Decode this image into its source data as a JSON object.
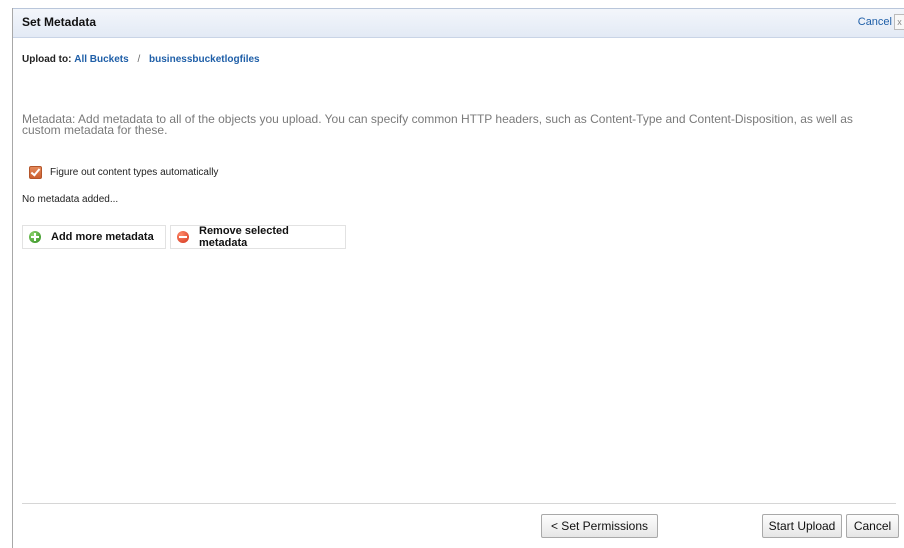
{
  "dialog": {
    "title": "Set Metadata",
    "header_cancel": "Cancel"
  },
  "breadcrumb": {
    "label": "Upload to:",
    "all_buckets": "All Buckets",
    "separator": "/",
    "bucket": "businessbucketlogfiles"
  },
  "description": "Metadata: Add metadata to all of the objects you upload. You can specify common HTTP headers, such as Content-Type and Content-Disposition, as well as custom metadata for these.",
  "content_types_checkbox": {
    "label": "Figure out content types automatically",
    "checked": true
  },
  "metadata_status": "No metadata added...",
  "actions": {
    "add_label": "Add more metadata",
    "remove_label": "Remove selected metadata"
  },
  "footer": {
    "back_label": "< Set Permissions",
    "start_label": "Start Upload",
    "cancel_label": "Cancel"
  },
  "colors": {
    "link": "#1f5fa8",
    "checkbox": "#cc5f2f",
    "add_icon": "#2e8b1e",
    "remove_icon": "#d2321b"
  },
  "icons": {
    "add": "plus-circle-icon",
    "remove": "minus-circle-icon",
    "checkbox": "checkbox-checked-icon"
  }
}
